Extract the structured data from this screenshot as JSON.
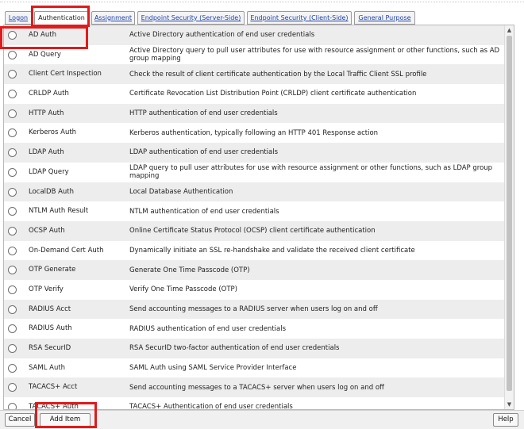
{
  "tabs": [
    {
      "label": "Logon",
      "active": false
    },
    {
      "label": "Authentication",
      "active": true
    },
    {
      "label": "Assignment",
      "active": false
    },
    {
      "label": "Endpoint Security (Server-Side)",
      "active": false
    },
    {
      "label": "Endpoint Security (Client-Side)",
      "active": false
    },
    {
      "label": "General Purpose",
      "active": false
    }
  ],
  "items": [
    {
      "name": "AD Auth",
      "description": "Active Directory authentication of end user credentials"
    },
    {
      "name": "AD Query",
      "description": "Active Directory query to pull user attributes for use with resource assignment or other functions, such as AD group mapping"
    },
    {
      "name": "Client Cert Inspection",
      "description": "Check the result of client certificate authentication by the Local Traffic Client SSL profile"
    },
    {
      "name": "CRLDP Auth",
      "description": "Certificate Revocation List Distribution Point (CRLDP) client certificate authentication"
    },
    {
      "name": "HTTP Auth",
      "description": "HTTP authentication of end user credentials"
    },
    {
      "name": "Kerberos Auth",
      "description": "Kerberos authentication, typically following an HTTP 401 Response action"
    },
    {
      "name": "LDAP Auth",
      "description": "LDAP authentication of end user credentials"
    },
    {
      "name": "LDAP Query",
      "description": "LDAP query to pull user attributes for use with resource assignment or other functions, such as LDAP group mapping"
    },
    {
      "name": "LocalDB Auth",
      "description": "Local Database Authentication"
    },
    {
      "name": "NTLM Auth Result",
      "description": "NTLM authentication of end user credentials"
    },
    {
      "name": "OCSP Auth",
      "description": "Online Certificate Status Protocol (OCSP) client certificate authentication"
    },
    {
      "name": "On-Demand Cert Auth",
      "description": "Dynamically initiate an SSL re-handshake and validate the received client certificate"
    },
    {
      "name": "OTP Generate",
      "description": "Generate One Time Passcode (OTP)"
    },
    {
      "name": "OTP Verify",
      "description": "Verify One Time Passcode (OTP)"
    },
    {
      "name": "RADIUS Acct",
      "description": "Send accounting messages to a RADIUS server when users log on and off"
    },
    {
      "name": "RADIUS Auth",
      "description": "RADIUS authentication of end user credentials"
    },
    {
      "name": "RSA SecurID",
      "description": "RSA SecurID two-factor authentication of end user credentials"
    },
    {
      "name": "SAML Auth",
      "description": "SAML Auth using SAML Service Provider Interface"
    },
    {
      "name": "TACACS+ Acct",
      "description": "Send accounting messages to a TACACS+ server when users log on and off"
    },
    {
      "name": "TACACS+ Auth",
      "description": "TACACS+ Authentication of end user credentials"
    }
  ],
  "buttons": {
    "cancel": "Cancel",
    "add_item": "Add Item",
    "help": "Help"
  },
  "scrollbar": {
    "up_icon": "▲",
    "down_icon": "▼"
  },
  "colors": {
    "highlight": "#e01b1b",
    "alt_row": "#ededed",
    "link": "#1a3fb0"
  }
}
